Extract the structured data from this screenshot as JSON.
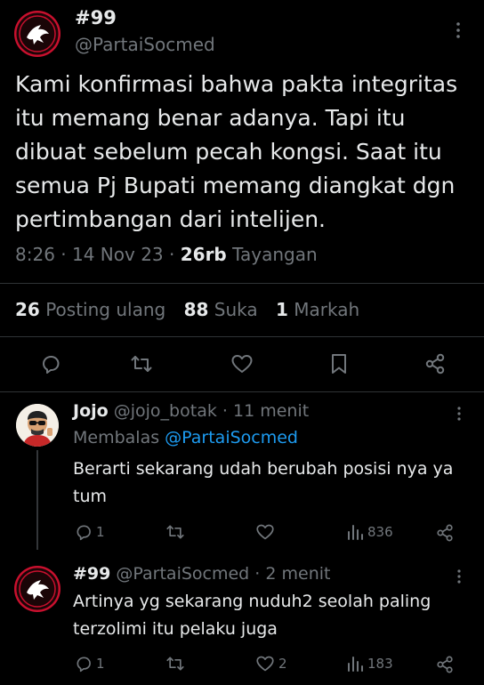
{
  "main_tweet": {
    "display_name": "#99",
    "handle": "@PartaiSocmed",
    "text": "Kami konfirmasi bahwa pakta integritas itu memang benar adanya. Tapi itu dibuat sebelum pecah kongsi. Saat itu semua Pj Bupati memang diangkat dgn pertimbangan dari intelijen.",
    "time": "8:26",
    "date": "14 Nov 23",
    "views_count": "26rb",
    "views_label": "Tayangan",
    "retweets_count": "26",
    "retweets_label": "Posting ulang",
    "likes_count": "88",
    "likes_label": "Suka",
    "bookmarks_count": "1",
    "bookmarks_label": "Markah",
    "avatar_colors": {
      "ring": "#c8102e",
      "bg": "#1a0507",
      "bird": "#ffffff"
    }
  },
  "replies": [
    {
      "display_name": "Jojo",
      "handle": "@jojo_botak",
      "time_ago": "11 menit",
      "replying_label": "Membalas",
      "replying_to": "@PartaiSocmed",
      "text": "Berarti sekarang udah berubah posisi nya ya tum",
      "reply_count": "1",
      "retweet_count": "",
      "like_count": "",
      "view_count": "836"
    },
    {
      "display_name": "#99",
      "handle": "@PartaiSocmed",
      "time_ago": "2 menit",
      "text": "Artinya yg sekarang nuduh2 seolah paling terzolimi itu pelaku juga",
      "reply_count": "1",
      "retweet_count": "",
      "like_count": "2",
      "view_count": "183"
    }
  ],
  "separators": {
    "dot": "·"
  },
  "colors": {
    "background": "#000000",
    "text": "#e7e9ea",
    "muted": "#71767b",
    "link": "#1d9bf0",
    "divider": "#2f3336"
  },
  "icons": [
    "more-icon",
    "reply-icon",
    "retweet-icon",
    "like-icon",
    "bookmark-icon",
    "share-icon",
    "views-icon"
  ]
}
